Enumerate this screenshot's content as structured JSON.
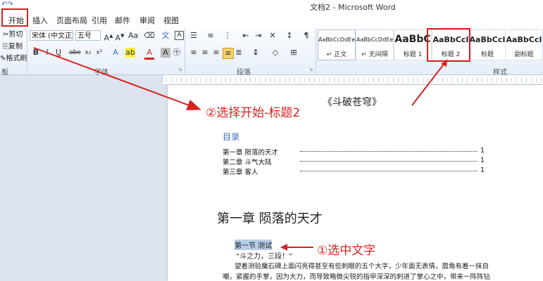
{
  "window": {
    "title": "文档2 - Microsoft Word"
  },
  "tabs": [
    {
      "label": "开始",
      "active": true
    },
    {
      "label": "插入"
    },
    {
      "label": "页面布局"
    },
    {
      "label": "引用"
    },
    {
      "label": "邮件"
    },
    {
      "label": "审阅"
    },
    {
      "label": "视图"
    }
  ],
  "ribbon": {
    "clipboard": {
      "cut": "剪切",
      "copy": "复制",
      "format_painter": "格式刷",
      "group": "板"
    },
    "font": {
      "name": "宋体 (中文正文",
      "size": "五号",
      "group": "字体"
    },
    "paragraph": {
      "group": "段落"
    },
    "styles": {
      "group": "样式",
      "items": [
        {
          "sample": "AaBbCcDdEe",
          "name": "↵ 正文"
        },
        {
          "sample": "AaBbCcDdEe",
          "name": "↵ 无间隔"
        },
        {
          "sample": "AaBbC",
          "name": "标题 1"
        },
        {
          "sample": "AaBbCcI",
          "name": "标题 2",
          "highlighted": true
        },
        {
          "sample": "AaBbCcI",
          "name": "标题"
        },
        {
          "sample": "AaBbCcI",
          "name": "副标题"
        }
      ]
    }
  },
  "annotations": {
    "step2": "②选择开始-标题2",
    "step1": "①选中文字"
  },
  "document": {
    "book_title": "《斗破苍穹》",
    "toc_heading": "目录",
    "toc": [
      {
        "text": "第一章  陨落的天才",
        "page": "1"
      },
      {
        "text": "第二章  斗气大陆",
        "page": "1"
      },
      {
        "text": "第三章  客人",
        "page": "1"
      }
    ],
    "chapter_heading": "第一章  陨落的天才",
    "section": "第一节  测试",
    "quote": "“斗之力，三段！”",
    "body1": "望着测验魔石碑上面闪亮得甚至有些刺眼的五个大字，少年面无表情，唇角有着一抹自",
    "body2": "嘲，紧握的手掌，因为大力，而导致略微尖锐的指甲深深的刺进了掌心之中，带来一阵阵钻"
  },
  "colors": {
    "annotation_red": "#d8221f",
    "accent_blue": "#3a6bc4"
  }
}
